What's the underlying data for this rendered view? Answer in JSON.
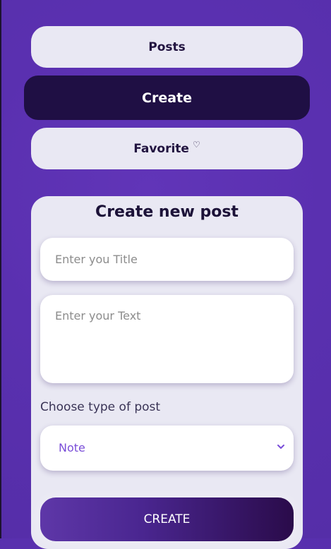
{
  "nav": {
    "posts_label": "Posts",
    "create_label": "Create",
    "favorite_label": "Favorite",
    "favorite_icon": "heart-outline-icon"
  },
  "form": {
    "title": "Create new post",
    "title_placeholder": "Enter you Title",
    "text_placeholder": "Enter your Text",
    "type_label": "Choose type of post",
    "type_selected": "Note",
    "submit_label": "CREATE"
  },
  "colors": {
    "background": "#5a30b0",
    "active_nav": "#1f0f44",
    "nav": "#e9e8f3",
    "select_text": "#7a4ed8"
  }
}
